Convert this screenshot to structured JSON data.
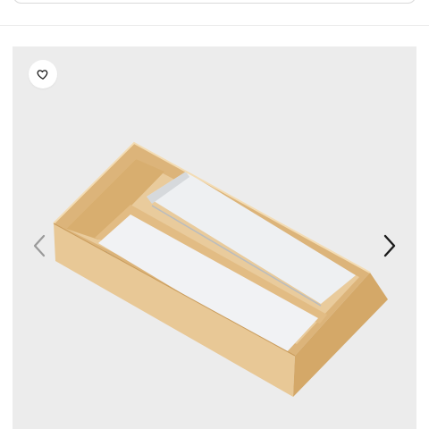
{
  "colors": {
    "gallery_background": "#ececec",
    "wood": "#e6c48f",
    "wood_dark": "#cfa466",
    "foil": "#eef0f2",
    "arrow_prev": "#9a9a9a",
    "arrow_next": "#1a1a1a"
  },
  "icons": {
    "favorite": "heart-outline-icon",
    "prev": "chevron-left-icon",
    "next": "chevron-right-icon"
  },
  "gallery": {
    "image": "bamboo-wrap-dispenser-organizer"
  }
}
